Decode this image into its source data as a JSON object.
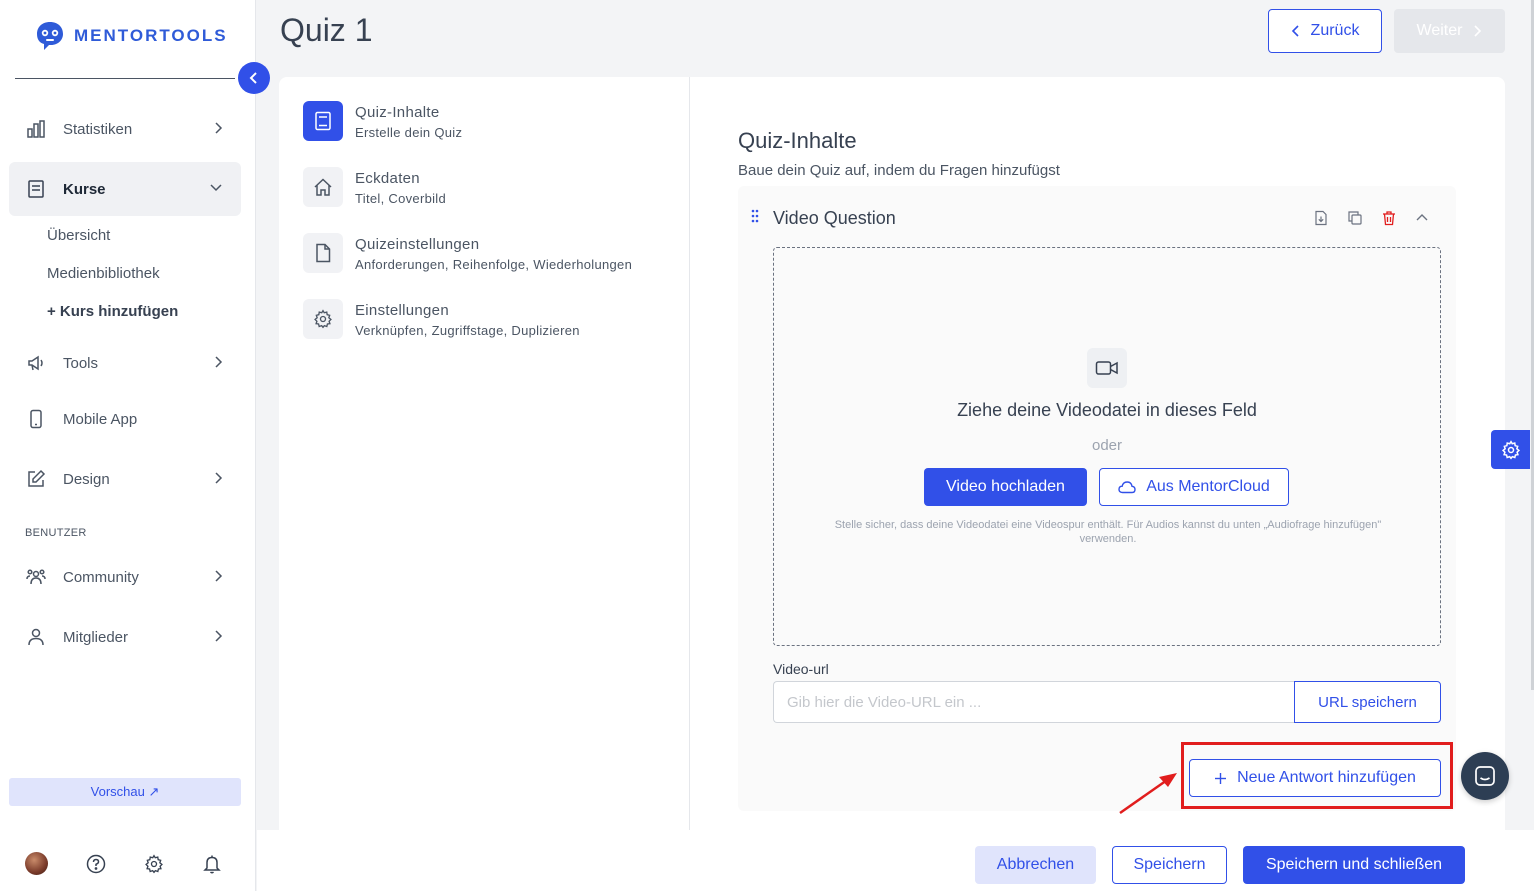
{
  "brand": {
    "name": "MENTORTOOLS"
  },
  "sidebar": {
    "nav": [
      {
        "label": "Statistiken",
        "icon": "bar-chart-icon"
      },
      {
        "label": "Kurse",
        "icon": "book-icon"
      },
      {
        "label": "Tools",
        "icon": "megaphone-icon"
      },
      {
        "label": "Mobile App",
        "icon": "smartphone-icon"
      },
      {
        "label": "Design",
        "icon": "pencil-icon"
      },
      {
        "label": "Community",
        "icon": "users-icon"
      },
      {
        "label": "Mitglieder",
        "icon": "user-icon"
      }
    ],
    "sub_items": [
      "Übersicht",
      "Medienbibliothek",
      "+ Kurs hinzufügen"
    ],
    "section_label": "BENUTZER",
    "preview_label": "Vorschau ↗"
  },
  "header": {
    "title": "Quiz 1",
    "back_label": "Zurück",
    "next_label": "Weiter"
  },
  "steps": [
    {
      "title": "Quiz-Inhalte",
      "subtitle": "Erstelle dein Quiz",
      "icon": "book-icon",
      "active": true
    },
    {
      "title": "Eckdaten",
      "subtitle": "Titel, Coverbild",
      "icon": "home-icon",
      "active": false
    },
    {
      "title": "Quizeinstellungen",
      "subtitle": "Anforderungen, Reihenfolge, Wiederholungen",
      "icon": "file-icon",
      "active": false
    },
    {
      "title": "Einstellungen",
      "subtitle": "Verknüpfen, Zugriffstage, Duplizieren",
      "icon": "gear-icon",
      "active": false
    }
  ],
  "content": {
    "title": "Quiz-Inhalte",
    "subtitle": "Baue dein Quiz auf, indem du Fragen hinzufügst",
    "question": {
      "title": "Video Question",
      "dropzone": {
        "headline": "Ziehe deine Videodatei in dieses Feld",
        "or": "oder",
        "upload_label": "Video hochladen",
        "cloud_label": "Aus MentorCloud",
        "hint": "Stelle sicher, dass deine Videodatei eine Videospur enthält. Für Audios kannst du unten „Audiofrage hinzufügen\" verwenden."
      },
      "url_label": "Video-url",
      "url_placeholder": "Gib hier die Video-URL ein ...",
      "url_value": "",
      "url_save_label": "URL speichern",
      "add_answer_label": "Neue Antwort hinzufügen"
    }
  },
  "footer": {
    "cancel_label": "Abbrechen",
    "save_label": "Speichern",
    "save_close_label": "Speichern und schließen"
  },
  "colors": {
    "primary": "#3150e8",
    "danger": "#e11d1d",
    "chat": "#2d3e54"
  }
}
